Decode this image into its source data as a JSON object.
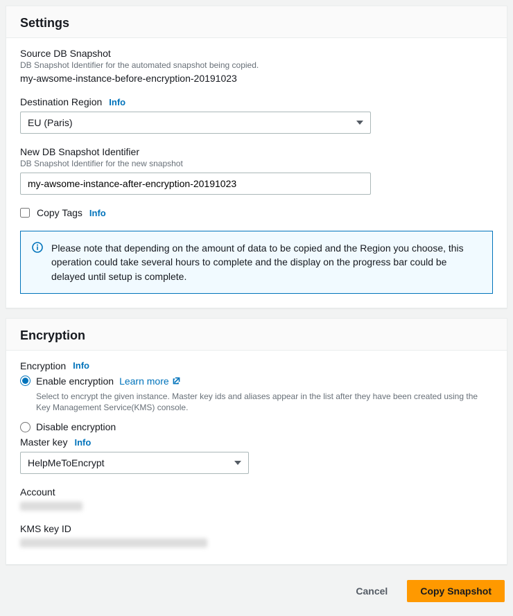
{
  "settings": {
    "title": "Settings",
    "source": {
      "label": "Source DB Snapshot",
      "desc": "DB Snapshot Identifier for the automated snapshot being copied.",
      "value": "my-awsome-instance-before-encryption-20191023"
    },
    "region": {
      "label": "Destination Region",
      "info": "Info",
      "value": "EU (Paris)"
    },
    "new_id": {
      "label": "New DB Snapshot Identifier",
      "desc": "DB Snapshot Identifier for the new snapshot",
      "value": "my-awsome-instance-after-encryption-20191023"
    },
    "copy_tags": {
      "label": "Copy Tags",
      "info": "Info"
    },
    "alert": "Please note that depending on the amount of data to be copied and the Region you choose, this operation could take several hours to complete and the display on the progress bar could be delayed until setup is complete."
  },
  "encryption": {
    "title": "Encryption",
    "label": "Encryption",
    "info": "Info",
    "enable": {
      "label": "Enable encryption",
      "learn_more": "Learn more",
      "desc": "Select to encrypt the given instance. Master key ids and aliases appear in the list after they have been created using the Key Management Service(KMS) console."
    },
    "disable": {
      "label": "Disable encryption"
    },
    "master_key": {
      "label": "Master key",
      "info": "Info",
      "value": "HelpMeToEncrypt"
    },
    "account": {
      "label": "Account"
    },
    "kms_id": {
      "label": "KMS key ID"
    }
  },
  "footer": {
    "cancel": "Cancel",
    "copy": "Copy Snapshot"
  }
}
